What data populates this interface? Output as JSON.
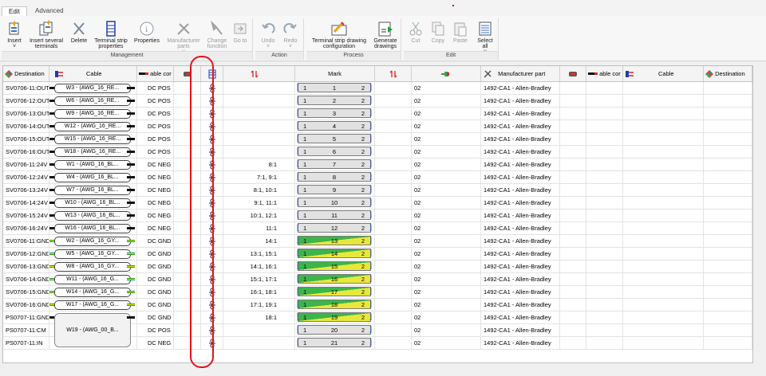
{
  "tabs": [
    {
      "label": "Edit",
      "active": true
    },
    {
      "label": "Advanced",
      "active": false
    }
  ],
  "ribbon": {
    "groups": [
      {
        "title": "Management",
        "buttons": [
          {
            "label": "Insert",
            "sub": "˅",
            "icon": "insert-icon",
            "enabled": true
          },
          {
            "label": "Insert several terminals",
            "icon": "insert-several-icon",
            "enabled": true
          },
          {
            "label": "Delete",
            "icon": "delete-icon",
            "enabled": true
          },
          {
            "label": "Terminal strip properties",
            "icon": "terminal-strip-properties-icon",
            "enabled": true
          },
          {
            "label": "Properties",
            "icon": "properties-icon",
            "enabled": true
          },
          {
            "label": "Manufacturer parts",
            "sub": "˅",
            "icon": "manufacturer-parts-icon",
            "enabled": false
          },
          {
            "label": "Change function",
            "icon": "change-function-icon",
            "enabled": false
          },
          {
            "label": "Go to",
            "icon": "go-to-icon",
            "enabled": false
          }
        ]
      },
      {
        "title": "Action",
        "buttons": [
          {
            "label": "Undo",
            "sub": "˅",
            "icon": "undo-icon",
            "enabled": false
          },
          {
            "label": "Redo",
            "sub": "˅",
            "icon": "redo-icon",
            "enabled": false
          }
        ]
      },
      {
        "title": "Process",
        "buttons": [
          {
            "label": "Terminal strip drawing configuration",
            "icon": "drawing-configuration-icon",
            "enabled": true
          },
          {
            "label": "Generate drawings",
            "icon": "generate-drawings-icon",
            "enabled": true
          }
        ]
      },
      {
        "title": "Edit",
        "buttons": [
          {
            "label": "Cut",
            "icon": "cut-icon",
            "enabled": false
          },
          {
            "label": "Copy",
            "icon": "copy-icon",
            "enabled": false
          },
          {
            "label": "Paste",
            "icon": "paste-icon",
            "enabled": false
          },
          {
            "label": "Select all",
            "sub": "˅",
            "icon": "select-all-icon",
            "enabled": true
          }
        ]
      }
    ]
  },
  "grid": {
    "headers": {
      "destination": "Destination",
      "cable": "Cable",
      "cable_core": "able cor",
      "mark": "Mark",
      "manufacturer_part": "Manufacturer part",
      "cable_core_r": "able cor",
      "cable_r": "Cable",
      "destination_r": "Destination"
    },
    "rows": [
      {
        "dest": "SV0706-11:OUT",
        "cable": "W3 - (AWG_16_RE...",
        "core": "DC POS",
        "jumper": "",
        "mark": "1",
        "num": "1",
        "mark2": "2",
        "code": "02",
        "part": "1492-CA1 - Allen-Bradley",
        "gnd": false
      },
      {
        "dest": "SV0706-12:OUT",
        "cable": "W6 - (AWG_16_RE...",
        "core": "DC POS",
        "jumper": "",
        "mark": "1",
        "num": "2",
        "mark2": "2",
        "code": "02",
        "part": "1492-CA1 - Allen-Bradley",
        "gnd": false
      },
      {
        "dest": "SV0706-13:OUT",
        "cable": "W9 - (AWG_16_RE...",
        "core": "DC POS",
        "jumper": "",
        "mark": "1",
        "num": "3",
        "mark2": "2",
        "code": "02",
        "part": "1492-CA1 - Allen-Bradley",
        "gnd": false
      },
      {
        "dest": "SV0706-14:OUT",
        "cable": "W12 - (AWG_16_RE...",
        "core": "DC POS",
        "jumper": "",
        "mark": "1",
        "num": "4",
        "mark2": "2",
        "code": "02",
        "part": "1492-CA1 - Allen-Bradley",
        "gnd": false
      },
      {
        "dest": "SV0706-15:OUT",
        "cable": "W15 - (AWG_16_RE...",
        "core": "DC POS",
        "jumper": "",
        "mark": "1",
        "num": "5",
        "mark2": "2",
        "code": "02",
        "part": "1492-CA1 - Allen-Bradley",
        "gnd": false
      },
      {
        "dest": "SV0706-16:OUT",
        "cable": "W18 - (AWG_16_RE...",
        "core": "DC POS",
        "jumper": "",
        "mark": "1",
        "num": "6",
        "mark2": "2",
        "code": "02",
        "part": "1492-CA1 - Allen-Bradley",
        "gnd": false
      },
      {
        "dest": "SV0706-11:24V",
        "cable": "W1 - (AWG_16_BL...",
        "core": "DC NEG",
        "jumper": "8:1",
        "mark": "1",
        "num": "7",
        "mark2": "2",
        "code": "02",
        "part": "1492-CA1 - Allen-Bradley",
        "gnd": false
      },
      {
        "dest": "SV0706-12:24V",
        "cable": "W4 - (AWG_16_BL...",
        "core": "DC NEG",
        "jumper": "7:1, 9:1",
        "mark": "1",
        "num": "8",
        "mark2": "2",
        "code": "02",
        "part": "1492-CA1 - Allen-Bradley",
        "gnd": false
      },
      {
        "dest": "SV0706-13:24V",
        "cable": "W7 - (AWG_16_BL...",
        "core": "DC NEG",
        "jumper": "8:1, 10:1",
        "mark": "1",
        "num": "9",
        "mark2": "2",
        "code": "02",
        "part": "1492-CA1 - Allen-Bradley",
        "gnd": false
      },
      {
        "dest": "SV0706-14:24V",
        "cable": "W10 - (AWG_16_BL...",
        "core": "DC NEG",
        "jumper": "9:1, 11:1",
        "mark": "1",
        "num": "10",
        "mark2": "2",
        "code": "02",
        "part": "1492-CA1 - Allen-Bradley",
        "gnd": false
      },
      {
        "dest": "SV0706-15:24V",
        "cable": "W13 - (AWG_16_BL...",
        "core": "DC NEG",
        "jumper": "10:1, 12:1",
        "mark": "1",
        "num": "11",
        "mark2": "2",
        "code": "02",
        "part": "1492-CA1 - Allen-Bradley",
        "gnd": false
      },
      {
        "dest": "SV0706-16:24V",
        "cable": "W16 - (AWG_16_BL...",
        "core": "DC NEG",
        "jumper": "11:1",
        "mark": "1",
        "num": "12",
        "mark2": "2",
        "code": "02",
        "part": "1492-CA1 - Allen-Bradley",
        "gnd": false
      },
      {
        "dest": "SV0706-11:GND",
        "cable": "W2 - (AWG_16_GY...",
        "core": "DC GND",
        "jumper": "14:1",
        "mark": "1",
        "num": "13",
        "mark2": "2",
        "code": "02",
        "part": "1492-CA1 - Allen-Bradley",
        "gnd": true
      },
      {
        "dest": "SV0706-12:GND",
        "cable": "W5 - (AWG_16_GY...",
        "core": "DC GND",
        "jumper": "13:1, 15:1",
        "mark": "1",
        "num": "14",
        "mark2": "2",
        "code": "02",
        "part": "1492-CA1 - Allen-Bradley",
        "gnd": true
      },
      {
        "dest": "SV0706-13:GND",
        "cable": "W8 - (AWG_16_GY...",
        "core": "DC GND",
        "jumper": "14:1, 16:1",
        "mark": "1",
        "num": "15",
        "mark2": "2",
        "code": "02",
        "part": "1492-CA1 - Allen-Bradley",
        "gnd": true
      },
      {
        "dest": "SV0706-14:GND",
        "cable": "W11 - (AWG_16_G...",
        "core": "DC GND",
        "jumper": "15:1, 17:1",
        "mark": "1",
        "num": "16",
        "mark2": "2",
        "code": "02",
        "part": "1492-CA1 - Allen-Bradley",
        "gnd": true
      },
      {
        "dest": "SV0706-15:GND",
        "cable": "W14 - (AWG_16_G...",
        "core": "DC GND",
        "jumper": "16:1, 18:1",
        "mark": "1",
        "num": "17",
        "mark2": "2",
        "code": "02",
        "part": "1492-CA1 - Allen-Bradley",
        "gnd": true
      },
      {
        "dest": "SV0706-16:GND",
        "cable": "W17 - (AWG_16_G...",
        "core": "DC GND",
        "jumper": "17:1, 19:1",
        "mark": "1",
        "num": "18",
        "mark2": "2",
        "code": "02",
        "part": "1492-CA1 - Allen-Bradley",
        "gnd": true
      },
      {
        "dest": "PS0707-11:GND",
        "cable": "",
        "core": "DC GND",
        "jumper": "18:1",
        "mark": "1",
        "num": "19",
        "mark2": "2",
        "code": "02",
        "part": "1492-CA1 - Allen-Bradley",
        "gnd": true
      },
      {
        "dest": "PS0707-11:CM",
        "cable": "W19 - (AWG_00_B...",
        "core": "DC POS",
        "jumper": "",
        "mark": "1",
        "num": "20",
        "mark2": "2",
        "code": "02",
        "part": "1492-CA1 - Allen-Bradley",
        "gnd": false
      },
      {
        "dest": "PS0707-11:IN",
        "cable": "",
        "core": "DC NEG",
        "jumper": "",
        "mark": "1",
        "num": "21",
        "mark2": "2",
        "code": "02",
        "part": "1492-CA1 - Allen-Bradley",
        "gnd": false
      }
    ]
  },
  "colors": {
    "annotation": "#e0141e",
    "bracket": "#1a3fb0",
    "gnd_green": "#3cb54a",
    "gnd_yellow": "#e8e83a"
  }
}
